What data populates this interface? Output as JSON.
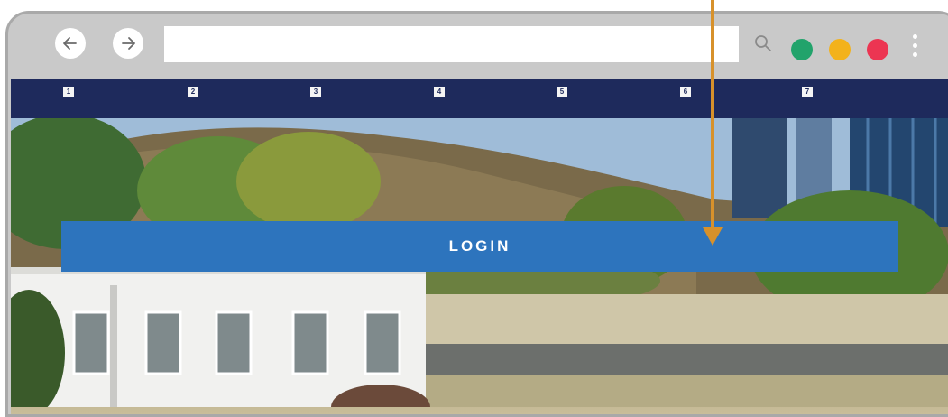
{
  "browser": {
    "address_value": "",
    "icons": {
      "back": "arrow-left-icon",
      "forward": "arrow-right-icon",
      "search": "search-icon",
      "menu": "kebab-menu-icon"
    },
    "window_buttons": {
      "green": "#22a36b",
      "yellow": "#f3b21b",
      "red": "#ec3552"
    }
  },
  "nav": {
    "items": [
      {
        "label": "1"
      },
      {
        "label": "2"
      },
      {
        "label": "3"
      },
      {
        "label": "4"
      },
      {
        "label": "5"
      },
      {
        "label": "6"
      },
      {
        "label": "7"
      }
    ]
  },
  "hero": {
    "login_label": "LOGIN"
  },
  "colors": {
    "navbar": "#1e2a5c",
    "login": "#2d74bd",
    "pointer": "#d7912b",
    "chrome": "#c9c9c9"
  }
}
